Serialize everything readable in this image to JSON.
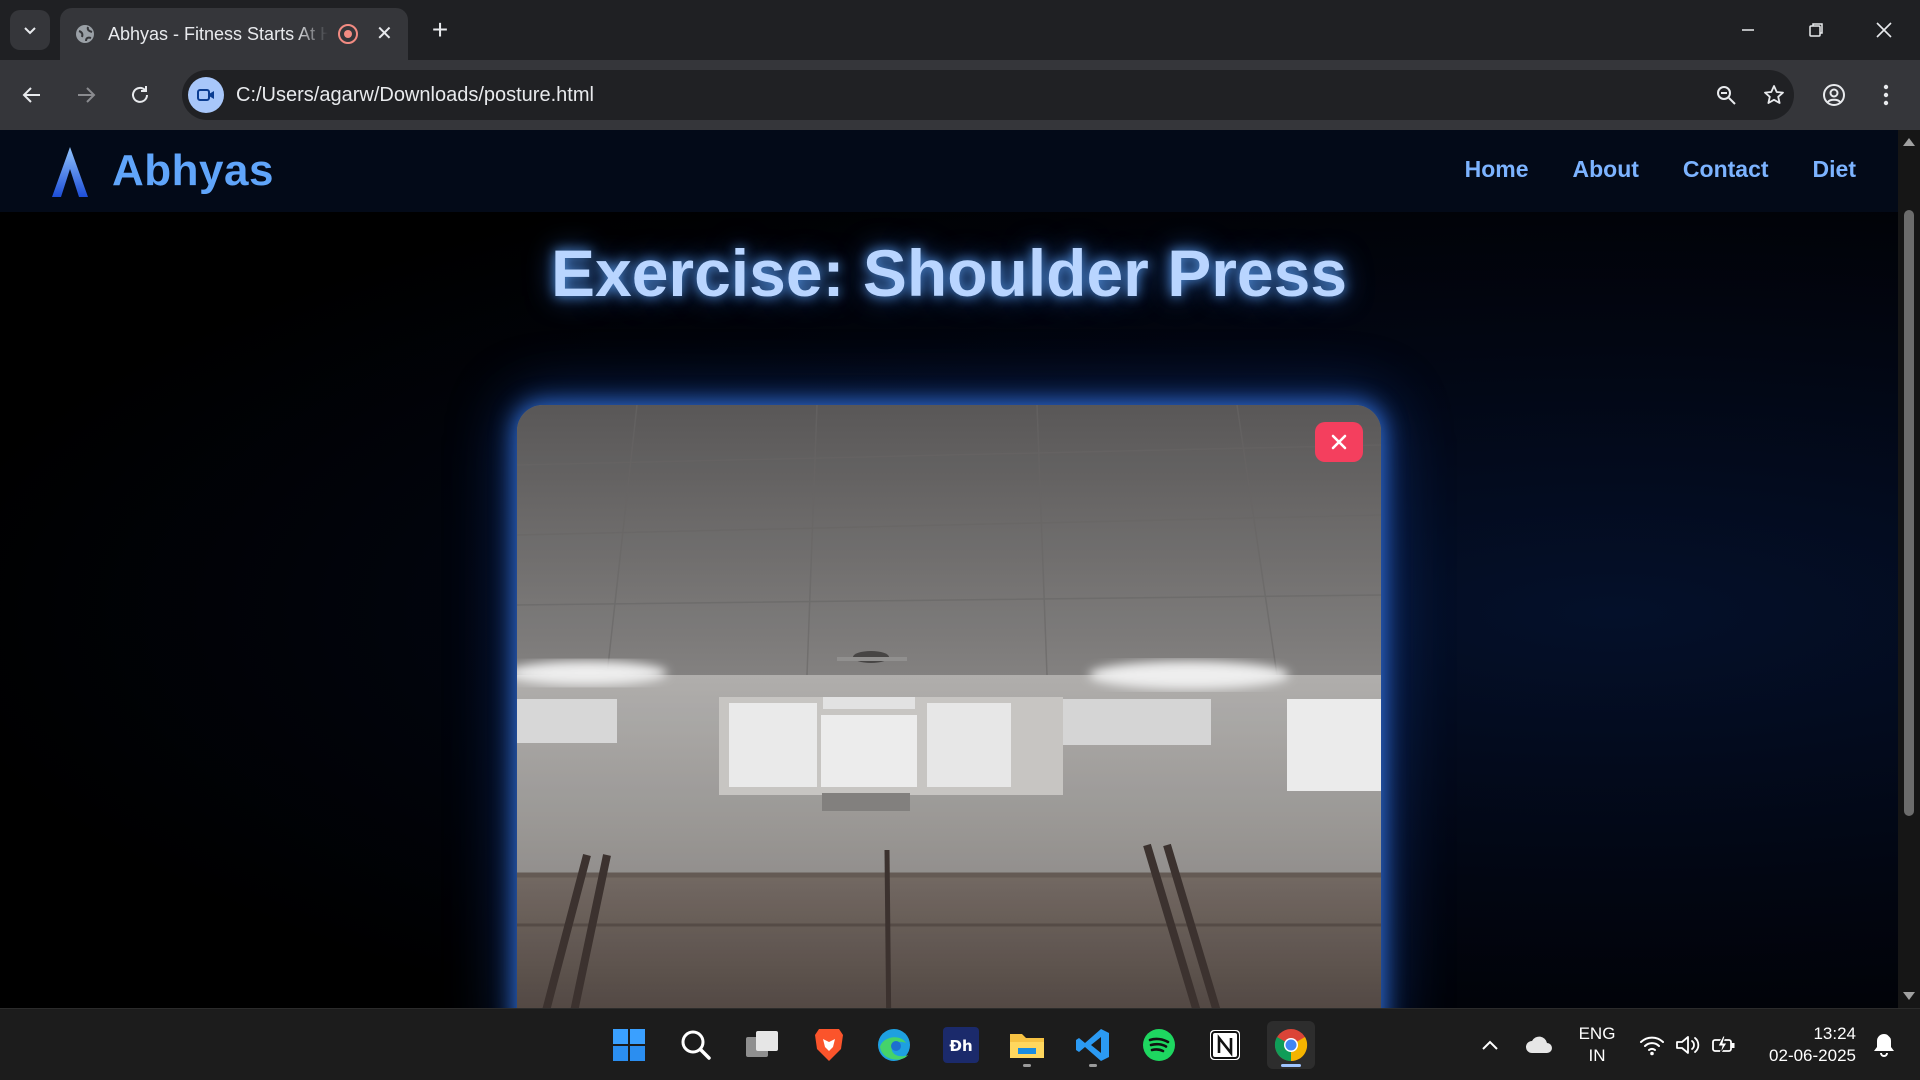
{
  "browser": {
    "tab": {
      "title": "Abhyas - Fitness Starts At Home"
    },
    "address_bar": {
      "url": "C:/Users/agarw/Downloads/posture.html"
    }
  },
  "site": {
    "logo_letter": "A",
    "logo_text": "Abhyas",
    "nav": [
      "Home",
      "About",
      "Contact",
      "Diet"
    ],
    "exercise_title": "Exercise: Shoulder Press",
    "stop_button": "✕"
  },
  "taskbar": {
    "apps": [
      "windows-start",
      "search",
      "task-view",
      "brave",
      "edge",
      "dh-app",
      "file-explorer",
      "vscode",
      "spotify",
      "notion",
      "chrome"
    ],
    "tray": {
      "language": "ENG",
      "region": "IN",
      "time": "13:24",
      "date": "02-06-2025"
    }
  },
  "colors": {
    "accent": "#60a5fa",
    "title_glow": "#3b82f6",
    "stop_button": "#f43f5e"
  }
}
